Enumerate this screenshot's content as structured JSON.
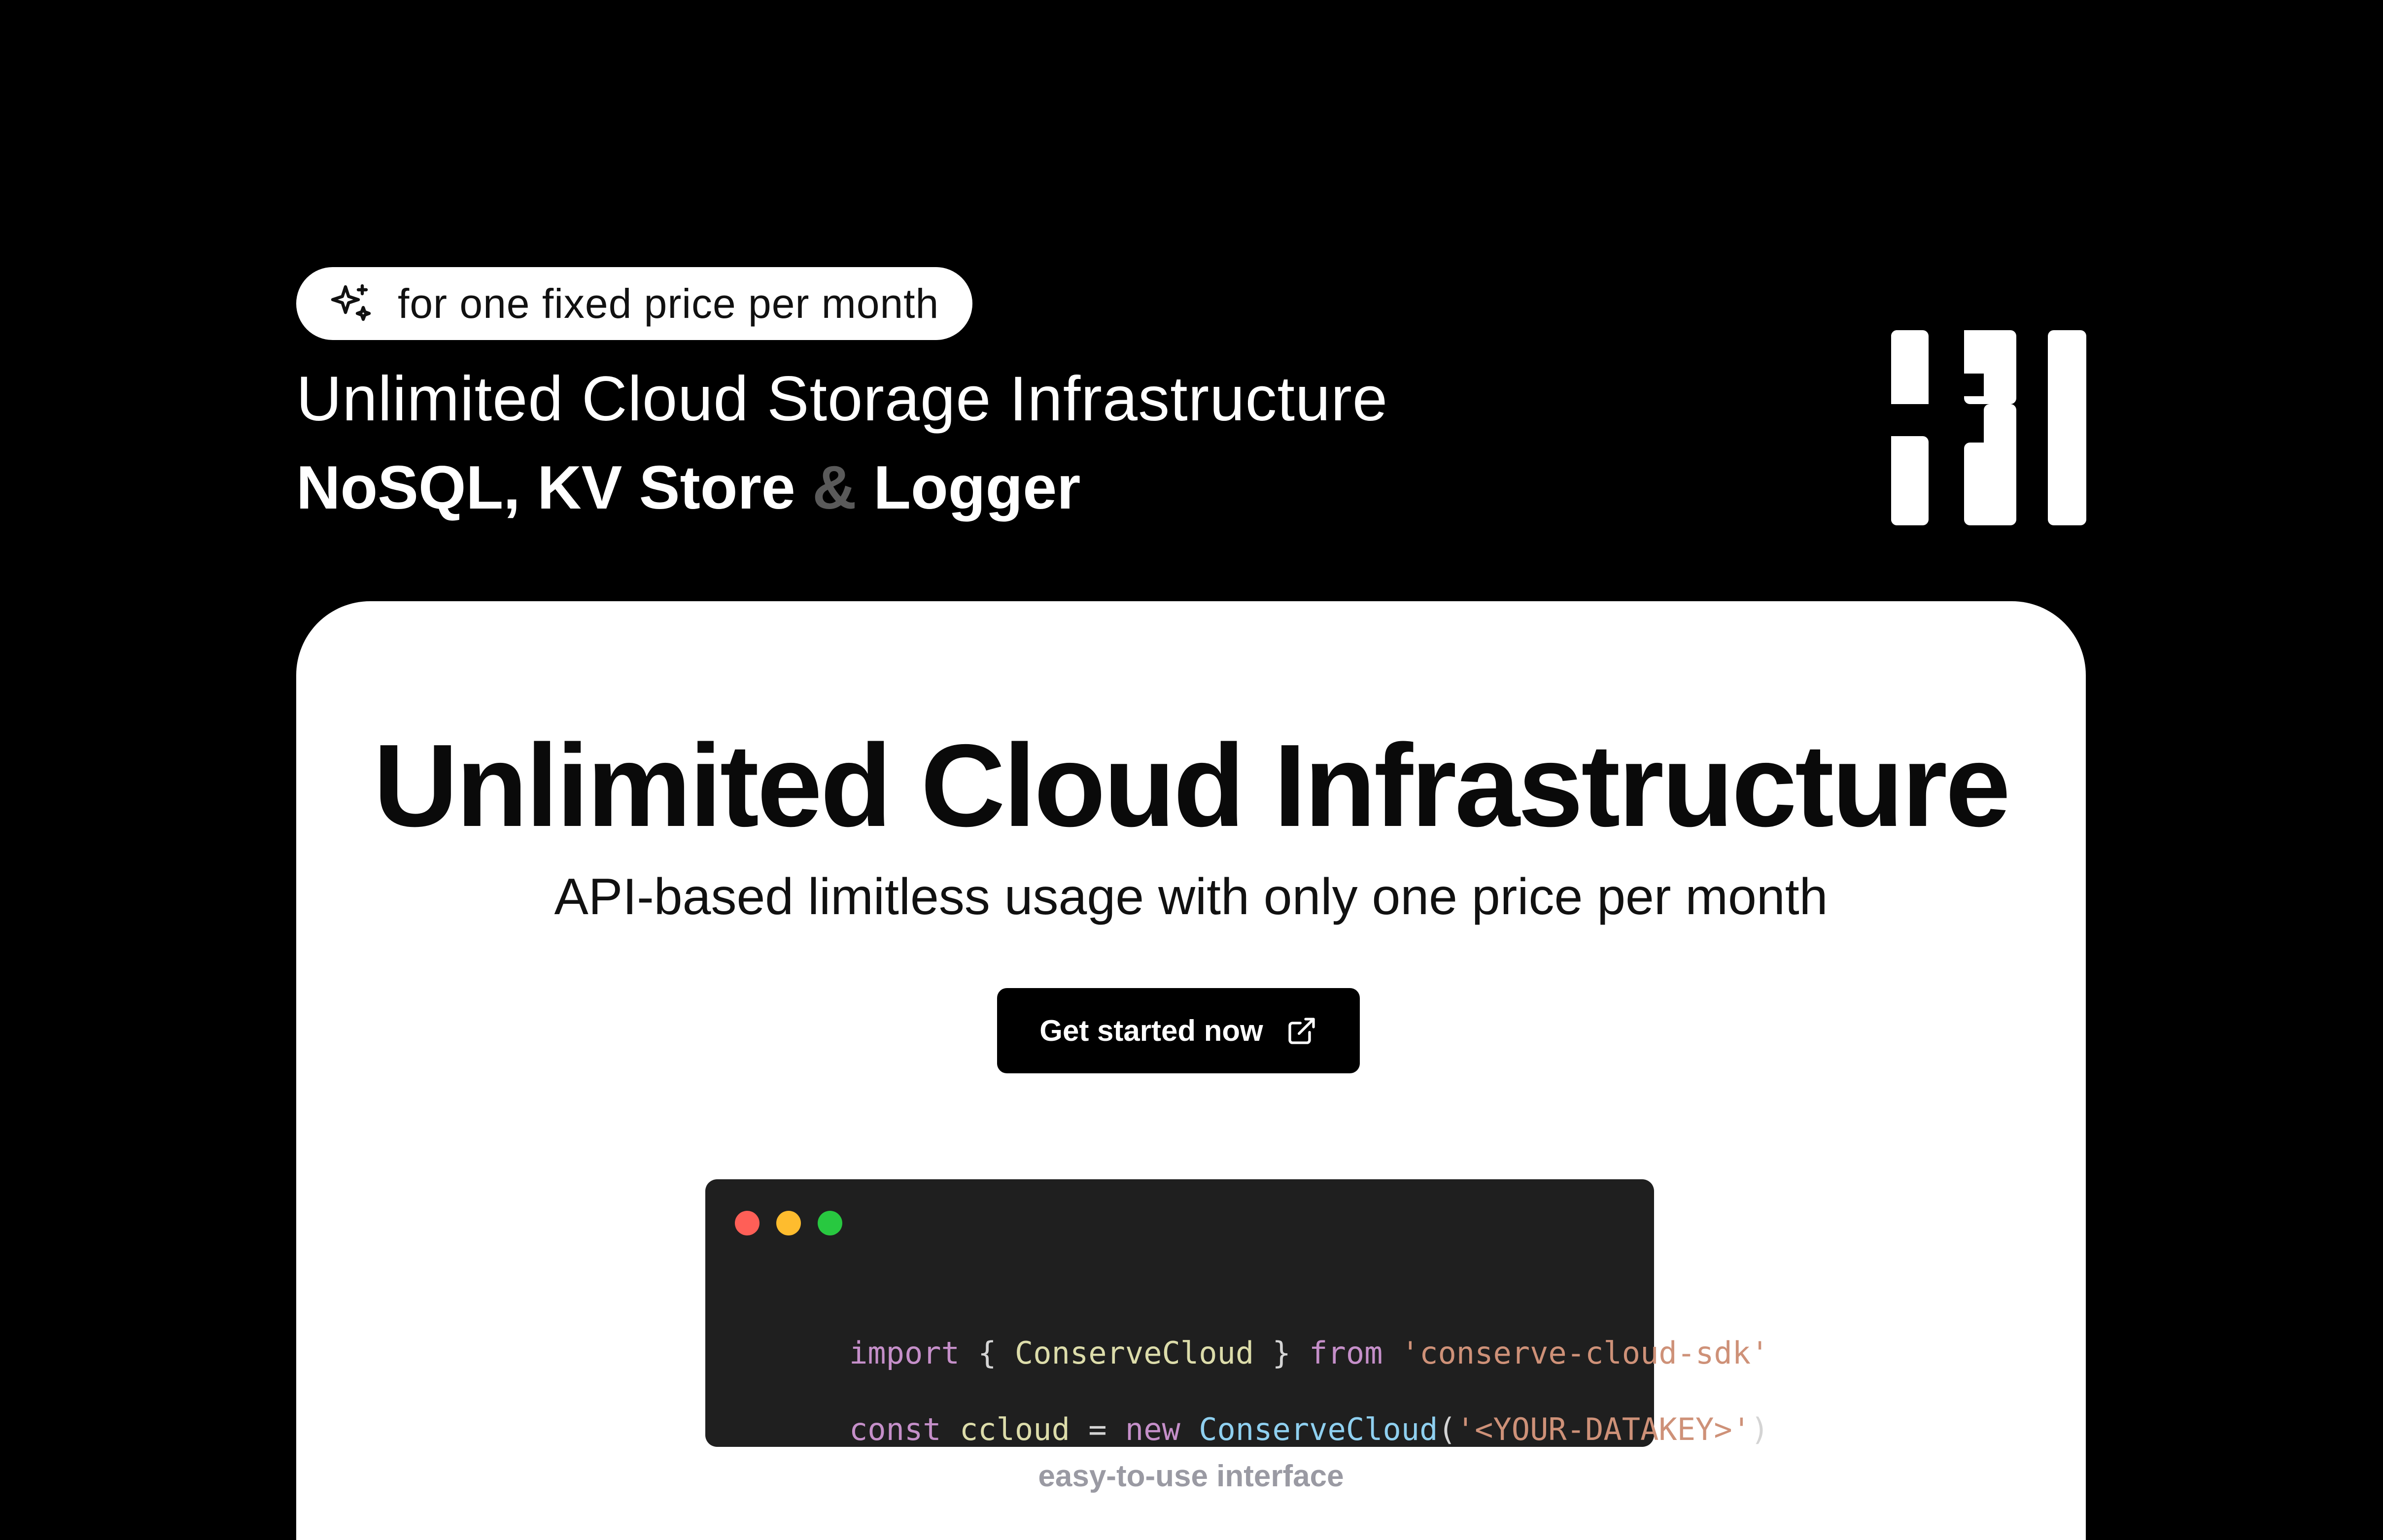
{
  "badge": {
    "icon": "sparkles-icon",
    "text": "for one fixed price per month"
  },
  "header": {
    "headline": "Unlimited Cloud Storage Infrastructure",
    "products_part1": "NoSQL, KV Store ",
    "products_amp": "&",
    "products_part2": " Logger"
  },
  "logo": {
    "icon": "brand-logo-icon"
  },
  "card": {
    "title": "Unlimited Cloud Infrastructure",
    "subtitle": "API-based limitless usage with only one price per month",
    "cta_label": "Get started now",
    "cta_icon": "external-link-icon",
    "caption": "easy-to-use interface"
  },
  "code": {
    "line1": [
      {
        "text": "import",
        "color": "#c58fc9"
      },
      {
        "text": " { ",
        "color": "#d4d4d4"
      },
      {
        "text": "ConserveCloud",
        "color": "#dcdcaa"
      },
      {
        "text": " } ",
        "color": "#d4d4d4"
      },
      {
        "text": "from",
        "color": "#c58fc9"
      },
      {
        "text": " 'conserve-cloud-sdk'",
        "color": "#ce9178"
      }
    ],
    "line2": [
      {
        "text": "const",
        "color": "#c58fc9"
      },
      {
        "text": " ",
        "color": "#d4d4d4"
      },
      {
        "text": "ccloud",
        "color": "#dcdcaa"
      },
      {
        "text": " = ",
        "color": "#d4d4d4"
      },
      {
        "text": "new",
        "color": "#c58fc9"
      },
      {
        "text": " ",
        "color": "#d4d4d4"
      },
      {
        "text": "ConserveCloud",
        "color": "#8fd0f0"
      },
      {
        "text": "(",
        "color": "#d4d4d4"
      },
      {
        "text": "'<YOUR-DATAKEY>'",
        "color": "#ce9178"
      },
      {
        "text": ")",
        "color": "#d4d4d4"
      }
    ]
  },
  "colors": {
    "page_background": "#000000",
    "card_background": "#ffffff",
    "code_background": "#1f1f1f",
    "dot_red": "#ff5f57",
    "dot_yellow": "#febc2e",
    "dot_green": "#28c840"
  }
}
